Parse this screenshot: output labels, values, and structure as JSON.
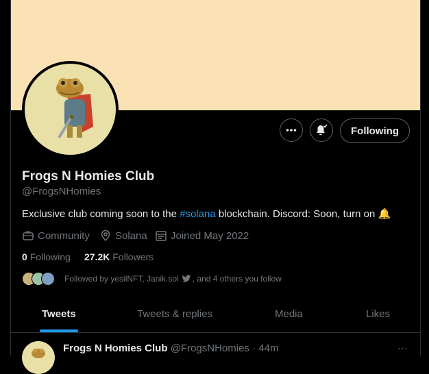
{
  "profile": {
    "name": "Frogs N Homies Club",
    "handle": "@FrogsNHomies",
    "bio_prefix": "Exclusive club coming soon to the ",
    "bio_hashtag": "#solana",
    "bio_suffix": "  blockchain. Discord: Soon, turn on",
    "bio_emoji": "🔔",
    "category": "Community",
    "location": "Solana",
    "joined": "Joined May 2022",
    "following_count": "0",
    "following_label": "Following",
    "followers_count": "27.2K",
    "followers_label": "Followers",
    "followed_by_text": "Followed by yesilNFT, Janik.sol",
    "followed_by_suffix": ", and 4 others you follow"
  },
  "actions": {
    "more_icon": "more-icon",
    "notify_icon": "bell-check-icon",
    "follow_label": "Following"
  },
  "tabs": [
    {
      "label": "Tweets",
      "active": true
    },
    {
      "label": "Tweets & replies",
      "active": false
    },
    {
      "label": "Media",
      "active": false
    },
    {
      "label": "Likes",
      "active": false
    }
  ],
  "tweet": {
    "name": "Frogs N Homies Club",
    "handle": "@FrogsNHomies",
    "separator": "·",
    "time": "44m",
    "more": "···"
  },
  "colors": {
    "banner": "#fbe2b5",
    "accent": "#1d9bf0",
    "avatar_bg": "#e9e0a8"
  }
}
